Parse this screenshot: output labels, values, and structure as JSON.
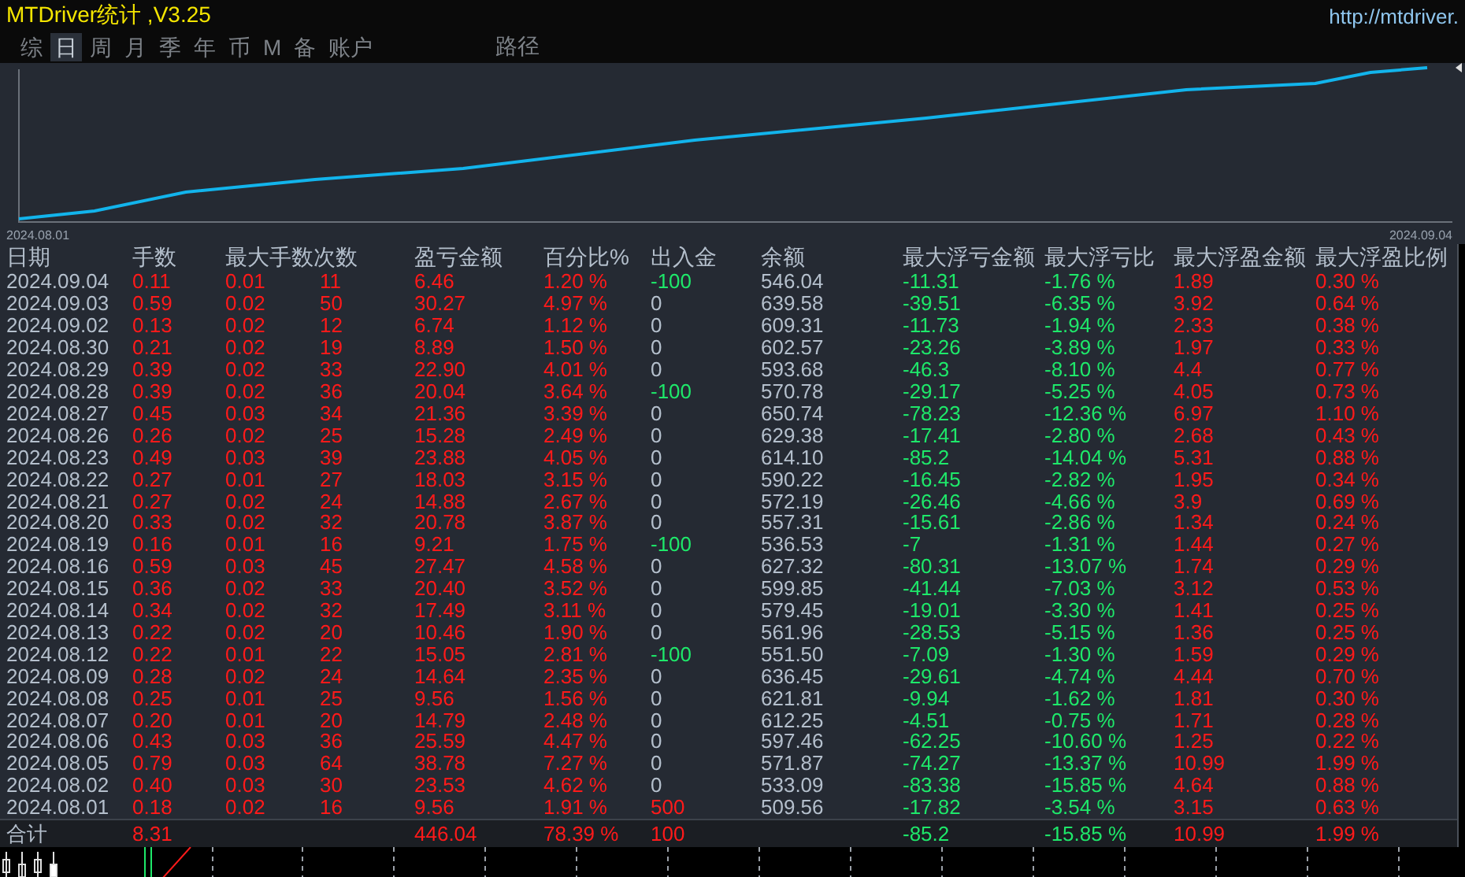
{
  "title_bar": {
    "title": "MTDriver统计 ,V3.25",
    "url": "http://mtdriver."
  },
  "tabs": [
    {
      "label": "综",
      "selected": false
    },
    {
      "label": "日",
      "selected": true
    },
    {
      "label": "周",
      "selected": false
    },
    {
      "label": "月",
      "selected": false
    },
    {
      "label": "季",
      "selected": false
    },
    {
      "label": "年",
      "selected": false
    },
    {
      "label": "币",
      "selected": false
    },
    {
      "label": "M",
      "selected": false
    },
    {
      "label": "备",
      "selected": false
    },
    {
      "label": "账户",
      "selected": false
    }
  ],
  "path_button": {
    "label": "路径"
  },
  "equity_chart": {
    "start_label": "2024.08.01",
    "end_label": "2024.09.04"
  },
  "table": {
    "columns": [
      {
        "header": "日期",
        "color": "#b4bfcc"
      },
      {
        "header": "手数",
        "color": "#ff1a1a"
      },
      {
        "header": "最大手数次数",
        "color": "#ff1a1a"
      },
      {
        "color": "#ff1a1a"
      },
      {
        "header": "盈亏金额",
        "color": "#ff1a1a"
      },
      {
        "header": "百分比%",
        "color": "#ff1a1a"
      },
      {
        "header": "出入金"
      },
      {
        "header": "余额",
        "color": "#b4bfcc"
      },
      {
        "header": "最大浮亏金额",
        "color": "#1ee86a"
      },
      {
        "header": "最大浮亏比",
        "color": "#1ee86a"
      },
      {
        "header": "最大浮盈金额",
        "color": "#ff1a1a"
      },
      {
        "header": "最大浮盈比例",
        "color": "#ff1a1a"
      }
    ],
    "rows": [
      {
        "cells": [
          "2024.09.04",
          "0.11",
          "0.01",
          "11",
          "6.46",
          "1.20 %",
          "-100",
          "546.04",
          "-11.31",
          "-1.76 %",
          "1.89",
          "0.30 %"
        ],
        "color": "#1ee86a"
      },
      {
        "cells": [
          "2024.09.03",
          "0.59",
          "0.02",
          "50",
          "30.27",
          "4.97 %",
          "0",
          "639.58",
          "-39.51",
          "-6.35 %",
          "3.92",
          "0.64 %"
        ],
        "color": "#b4bfcc"
      },
      {
        "cells": [
          "2024.09.02",
          "0.13",
          "0.02",
          "12",
          "6.74",
          "1.12 %",
          "0",
          "609.31",
          "-11.73",
          "-1.94 %",
          "2.33",
          "0.38 %"
        ],
        "color": "#b4bfcc"
      },
      {
        "cells": [
          "2024.08.30",
          "0.21",
          "0.02",
          "19",
          "8.89",
          "1.50 %",
          "0",
          "602.57",
          "-23.26",
          "-3.89 %",
          "1.97",
          "0.33 %"
        ],
        "color": "#b4bfcc"
      },
      {
        "cells": [
          "2024.08.29",
          "0.39",
          "0.02",
          "33",
          "22.90",
          "4.01 %",
          "0",
          "593.68",
          "-46.3",
          "-8.10 %",
          "4.4",
          "0.77 %"
        ],
        "color": "#b4bfcc"
      },
      {
        "cells": [
          "2024.08.28",
          "0.39",
          "0.02",
          "36",
          "20.04",
          "3.64 %",
          "-100",
          "570.78",
          "-29.17",
          "-5.25 %",
          "4.05",
          "0.73 %"
        ],
        "color": "#1ee86a"
      },
      {
        "cells": [
          "2024.08.27",
          "0.45",
          "0.03",
          "34",
          "21.36",
          "3.39 %",
          "0",
          "650.74",
          "-78.23",
          "-12.36 %",
          "6.97",
          "1.10 %"
        ],
        "color": "#b4bfcc"
      },
      {
        "cells": [
          "2024.08.26",
          "0.26",
          "0.02",
          "25",
          "15.28",
          "2.49 %",
          "0",
          "629.38",
          "-17.41",
          "-2.80 %",
          "2.68",
          "0.43 %"
        ],
        "color": "#b4bfcc"
      },
      {
        "cells": [
          "2024.08.23",
          "0.49",
          "0.03",
          "39",
          "23.88",
          "4.05 %",
          "0",
          "614.10",
          "-85.2",
          "-14.04 %",
          "5.31",
          "0.88 %"
        ],
        "color": "#b4bfcc"
      },
      {
        "cells": [
          "2024.08.22",
          "0.27",
          "0.01",
          "27",
          "18.03",
          "3.15 %",
          "0",
          "590.22",
          "-16.45",
          "-2.82 %",
          "1.95",
          "0.34 %"
        ],
        "color": "#b4bfcc"
      },
      {
        "cells": [
          "2024.08.21",
          "0.27",
          "0.02",
          "24",
          "14.88",
          "2.67 %",
          "0",
          "572.19",
          "-26.46",
          "-4.66 %",
          "3.9",
          "0.69 %"
        ],
        "color": "#b4bfcc"
      },
      {
        "cells": [
          "2024.08.20",
          "0.33",
          "0.02",
          "32",
          "20.78",
          "3.87 %",
          "0",
          "557.31",
          "-15.61",
          "-2.86 %",
          "1.34",
          "0.24 %"
        ],
        "color": "#b4bfcc"
      },
      {
        "cells": [
          "2024.08.19",
          "0.16",
          "0.01",
          "16",
          "9.21",
          "1.75 %",
          "-100",
          "536.53",
          "-7",
          "-1.31 %",
          "1.44",
          "0.27 %"
        ],
        "color": "#1ee86a"
      },
      {
        "cells": [
          "2024.08.16",
          "0.59",
          "0.03",
          "45",
          "27.47",
          "4.58 %",
          "0",
          "627.32",
          "-80.31",
          "-13.07 %",
          "1.74",
          "0.29 %"
        ],
        "color": "#b4bfcc"
      },
      {
        "cells": [
          "2024.08.15",
          "0.36",
          "0.02",
          "33",
          "20.40",
          "3.52 %",
          "0",
          "599.85",
          "-41.44",
          "-7.03 %",
          "3.12",
          "0.53 %"
        ],
        "color": "#b4bfcc"
      },
      {
        "cells": [
          "2024.08.14",
          "0.34",
          "0.02",
          "32",
          "17.49",
          "3.11 %",
          "0",
          "579.45",
          "-19.01",
          "-3.30 %",
          "1.41",
          "0.25 %"
        ],
        "color": "#b4bfcc"
      },
      {
        "cells": [
          "2024.08.13",
          "0.22",
          "0.02",
          "20",
          "10.46",
          "1.90 %",
          "0",
          "561.96",
          "-28.53",
          "-5.15 %",
          "1.36",
          "0.25 %"
        ],
        "color": "#b4bfcc"
      },
      {
        "cells": [
          "2024.08.12",
          "0.22",
          "0.01",
          "22",
          "15.05",
          "2.81 %",
          "-100",
          "551.50",
          "-7.09",
          "-1.30 %",
          "1.59",
          "0.29 %"
        ],
        "color": "#1ee86a"
      },
      {
        "cells": [
          "2024.08.09",
          "0.28",
          "0.02",
          "24",
          "14.64",
          "2.35 %",
          "0",
          "636.45",
          "-29.61",
          "-4.74 %",
          "4.44",
          "0.70 %"
        ],
        "color": "#b4bfcc"
      },
      {
        "cells": [
          "2024.08.08",
          "0.25",
          "0.01",
          "25",
          "9.56",
          "1.56 %",
          "0",
          "621.81",
          "-9.94",
          "-1.62 %",
          "1.81",
          "0.30 %"
        ],
        "color": "#b4bfcc"
      },
      {
        "cells": [
          "2024.08.07",
          "0.20",
          "0.01",
          "20",
          "14.79",
          "2.48 %",
          "0",
          "612.25",
          "-4.51",
          "-0.75 %",
          "1.71",
          "0.28 %"
        ],
        "color": "#b4bfcc"
      },
      {
        "cells": [
          "2024.08.06",
          "0.43",
          "0.03",
          "36",
          "25.59",
          "4.47 %",
          "0",
          "597.46",
          "-62.25",
          "-10.60 %",
          "1.25",
          "0.22 %"
        ],
        "color": "#b4bfcc"
      },
      {
        "cells": [
          "2024.08.05",
          "0.79",
          "0.03",
          "64",
          "38.78",
          "7.27 %",
          "0",
          "571.87",
          "-74.27",
          "-13.37 %",
          "10.99",
          "1.99 %"
        ],
        "color": "#b4bfcc"
      },
      {
        "cells": [
          "2024.08.02",
          "0.40",
          "0.03",
          "30",
          "23.53",
          "4.62 %",
          "0",
          "533.09",
          "-83.38",
          "-15.85 %",
          "4.64",
          "0.88 %"
        ],
        "color": "#b4bfcc"
      },
      {
        "cells": [
          "2024.08.01",
          "0.18",
          "0.02",
          "16",
          "9.56",
          "1.91 %",
          "500",
          "509.56",
          "-17.82",
          "-3.54 %",
          "3.15",
          "0.63 %"
        ],
        "color": "#ff1a1a"
      }
    ],
    "totals": {
      "cells": [
        "合计",
        "8.31",
        null,
        null,
        "446.04",
        "78.39 %",
        "100",
        null,
        "-85.2",
        "-15.85 %",
        "10.99",
        "1.99 %"
      ],
      "color": "#ff1a1a"
    }
  }
}
